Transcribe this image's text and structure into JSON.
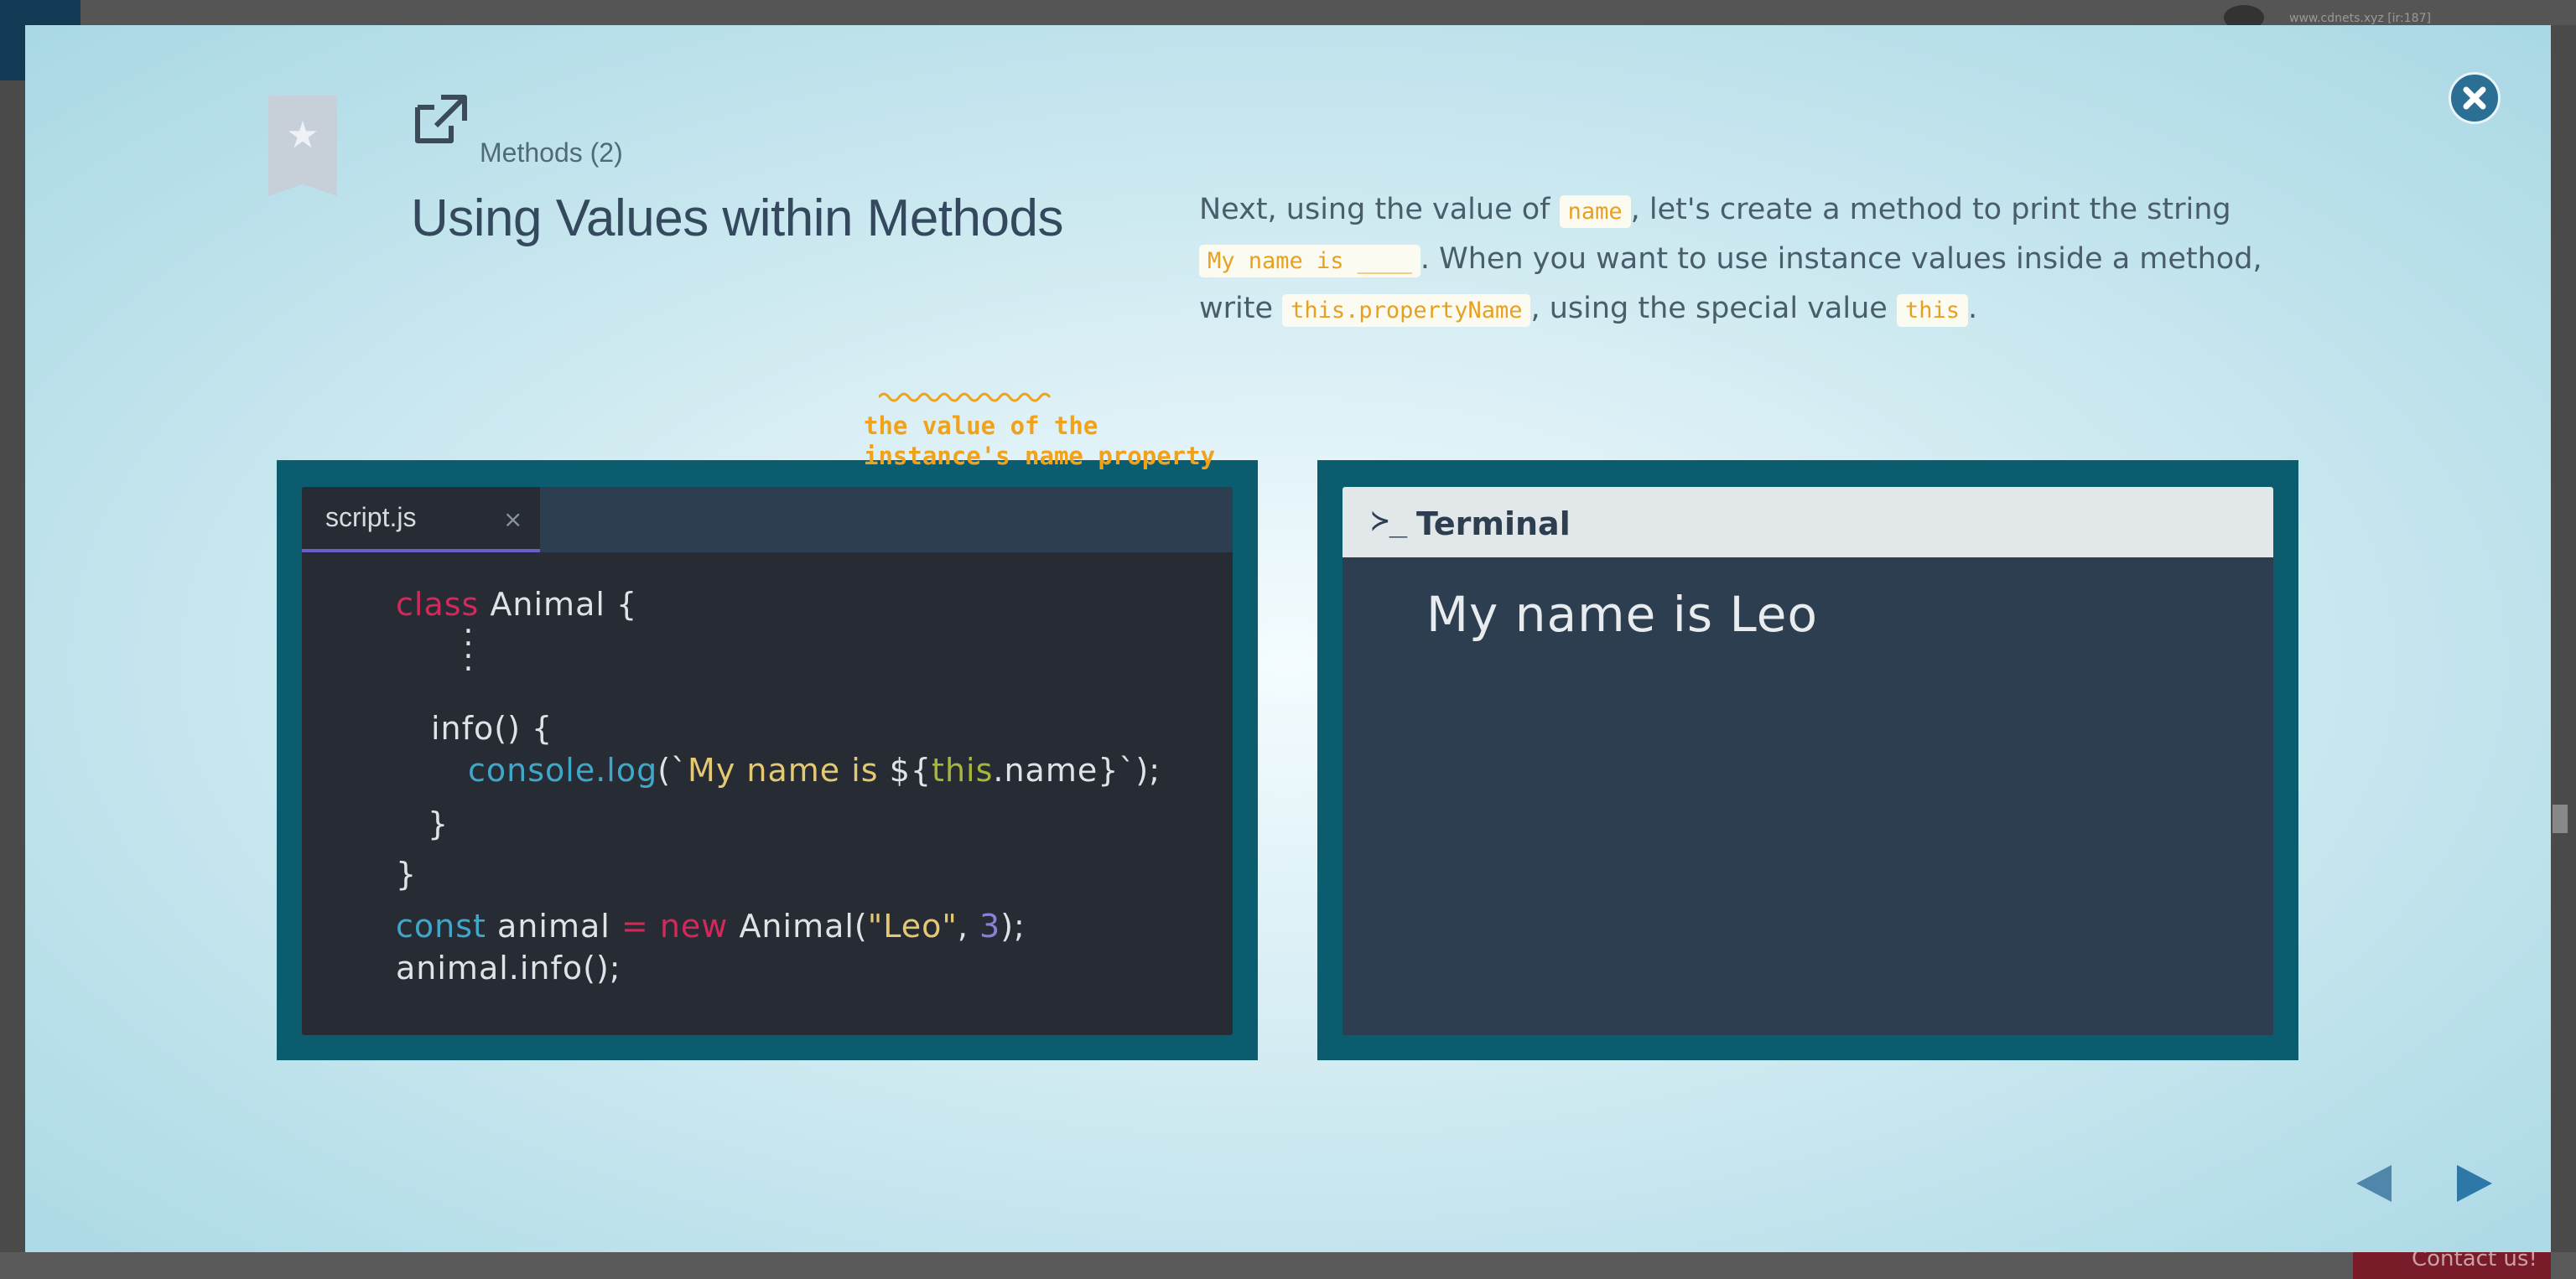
{
  "background": {
    "url_text": "www.cdnets.xyz [ir:187]",
    "contact_label": "Contact us!"
  },
  "header": {
    "breadcrumb": "Methods (2)",
    "title": "Using Values within Methods"
  },
  "description": {
    "part1": "Next, using the value of ",
    "chip1": "name",
    "part2": ", let's create a method to print the string ",
    "chip2": "My name is ____",
    "part3": ". When you want to use instance values inside a method, write ",
    "chip3": "this.propertyName",
    "part4": ", using the special value ",
    "chip4": "this",
    "part5": "."
  },
  "editor": {
    "tab_label": "script.js",
    "tab_close": "×",
    "lines": {
      "l1_kw": "class",
      "l1_rest": " Animal {",
      "l2": ":",
      "l3": ":",
      "l4": "info() {",
      "l5_fn": "console.log",
      "l5_open": "(`",
      "l5_str": "My name is ",
      "l5_dollar": "${",
      "l5_this": "this",
      "l5_prop": ".name",
      "l5_close": "}`);",
      "l6": "}",
      "l7": "}",
      "l8_kw": "const",
      "l8_var": " animal ",
      "l8_eq": "=",
      "l8_new": " new",
      "l8_cls": " Animal(",
      "l8_str": "\"Leo\"",
      "l8_comma": ", ",
      "l8_num": "3",
      "l8_end": ");",
      "l9": "animal.info();"
    },
    "note_line1": "the value of the",
    "note_line2": "instance's name property"
  },
  "terminal": {
    "prompt_icon": "≻_",
    "title": "Terminal",
    "output": "My name is Leo"
  },
  "colors": {
    "panel": "#0b5c6e",
    "editor_bg": "#272b33",
    "terminal_bg": "#2c3e50",
    "accent_orange": "#f0a21b",
    "keyword": "#d2285a",
    "function": "#3fa7c9"
  },
  "icons": {
    "bookmark": "bookmark-star-icon",
    "external": "external-link-icon",
    "close": "close-circle-icon",
    "prev": "triangle-left-icon",
    "next": "triangle-right-icon"
  }
}
